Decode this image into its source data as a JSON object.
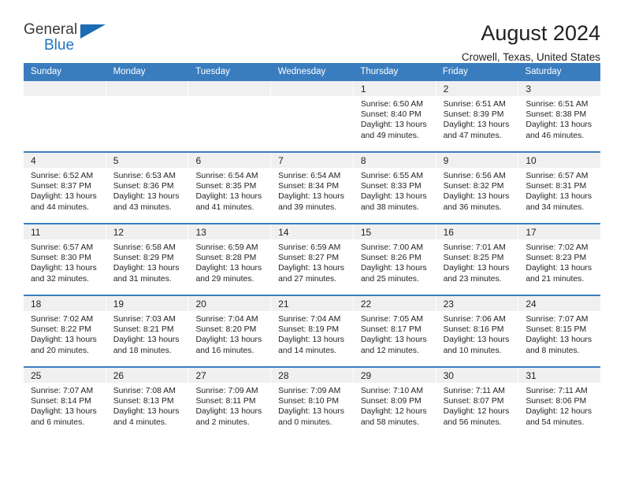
{
  "brand": {
    "name_top": "General",
    "name_bottom": "Blue",
    "color_primary": "#2077c0",
    "color_triangle": "#1b6cb3"
  },
  "header": {
    "title": "August 2024",
    "subtitle": "Crowell, Texas, United States"
  },
  "calendar": {
    "header_bg": "#3a7dbf",
    "day_header_bg": "#f0f0f0",
    "weekdays": [
      "Sunday",
      "Monday",
      "Tuesday",
      "Wednesday",
      "Thursday",
      "Friday",
      "Saturday"
    ],
    "weeks": [
      [
        {
          "day": "",
          "empty": true
        },
        {
          "day": "",
          "empty": true
        },
        {
          "day": "",
          "empty": true
        },
        {
          "day": "",
          "empty": true
        },
        {
          "day": "1",
          "sunrise": "Sunrise: 6:50 AM",
          "sunset": "Sunset: 8:40 PM",
          "daylight": "Daylight: 13 hours and 49 minutes."
        },
        {
          "day": "2",
          "sunrise": "Sunrise: 6:51 AM",
          "sunset": "Sunset: 8:39 PM",
          "daylight": "Daylight: 13 hours and 47 minutes."
        },
        {
          "day": "3",
          "sunrise": "Sunrise: 6:51 AM",
          "sunset": "Sunset: 8:38 PM",
          "daylight": "Daylight: 13 hours and 46 minutes."
        }
      ],
      [
        {
          "day": "4",
          "sunrise": "Sunrise: 6:52 AM",
          "sunset": "Sunset: 8:37 PM",
          "daylight": "Daylight: 13 hours and 44 minutes."
        },
        {
          "day": "5",
          "sunrise": "Sunrise: 6:53 AM",
          "sunset": "Sunset: 8:36 PM",
          "daylight": "Daylight: 13 hours and 43 minutes."
        },
        {
          "day": "6",
          "sunrise": "Sunrise: 6:54 AM",
          "sunset": "Sunset: 8:35 PM",
          "daylight": "Daylight: 13 hours and 41 minutes."
        },
        {
          "day": "7",
          "sunrise": "Sunrise: 6:54 AM",
          "sunset": "Sunset: 8:34 PM",
          "daylight": "Daylight: 13 hours and 39 minutes."
        },
        {
          "day": "8",
          "sunrise": "Sunrise: 6:55 AM",
          "sunset": "Sunset: 8:33 PM",
          "daylight": "Daylight: 13 hours and 38 minutes."
        },
        {
          "day": "9",
          "sunrise": "Sunrise: 6:56 AM",
          "sunset": "Sunset: 8:32 PM",
          "daylight": "Daylight: 13 hours and 36 minutes."
        },
        {
          "day": "10",
          "sunrise": "Sunrise: 6:57 AM",
          "sunset": "Sunset: 8:31 PM",
          "daylight": "Daylight: 13 hours and 34 minutes."
        }
      ],
      [
        {
          "day": "11",
          "sunrise": "Sunrise: 6:57 AM",
          "sunset": "Sunset: 8:30 PM",
          "daylight": "Daylight: 13 hours and 32 minutes."
        },
        {
          "day": "12",
          "sunrise": "Sunrise: 6:58 AM",
          "sunset": "Sunset: 8:29 PM",
          "daylight": "Daylight: 13 hours and 31 minutes."
        },
        {
          "day": "13",
          "sunrise": "Sunrise: 6:59 AM",
          "sunset": "Sunset: 8:28 PM",
          "daylight": "Daylight: 13 hours and 29 minutes."
        },
        {
          "day": "14",
          "sunrise": "Sunrise: 6:59 AM",
          "sunset": "Sunset: 8:27 PM",
          "daylight": "Daylight: 13 hours and 27 minutes."
        },
        {
          "day": "15",
          "sunrise": "Sunrise: 7:00 AM",
          "sunset": "Sunset: 8:26 PM",
          "daylight": "Daylight: 13 hours and 25 minutes."
        },
        {
          "day": "16",
          "sunrise": "Sunrise: 7:01 AM",
          "sunset": "Sunset: 8:25 PM",
          "daylight": "Daylight: 13 hours and 23 minutes."
        },
        {
          "day": "17",
          "sunrise": "Sunrise: 7:02 AM",
          "sunset": "Sunset: 8:23 PM",
          "daylight": "Daylight: 13 hours and 21 minutes."
        }
      ],
      [
        {
          "day": "18",
          "sunrise": "Sunrise: 7:02 AM",
          "sunset": "Sunset: 8:22 PM",
          "daylight": "Daylight: 13 hours and 20 minutes."
        },
        {
          "day": "19",
          "sunrise": "Sunrise: 7:03 AM",
          "sunset": "Sunset: 8:21 PM",
          "daylight": "Daylight: 13 hours and 18 minutes."
        },
        {
          "day": "20",
          "sunrise": "Sunrise: 7:04 AM",
          "sunset": "Sunset: 8:20 PM",
          "daylight": "Daylight: 13 hours and 16 minutes."
        },
        {
          "day": "21",
          "sunrise": "Sunrise: 7:04 AM",
          "sunset": "Sunset: 8:19 PM",
          "daylight": "Daylight: 13 hours and 14 minutes."
        },
        {
          "day": "22",
          "sunrise": "Sunrise: 7:05 AM",
          "sunset": "Sunset: 8:17 PM",
          "daylight": "Daylight: 13 hours and 12 minutes."
        },
        {
          "day": "23",
          "sunrise": "Sunrise: 7:06 AM",
          "sunset": "Sunset: 8:16 PM",
          "daylight": "Daylight: 13 hours and 10 minutes."
        },
        {
          "day": "24",
          "sunrise": "Sunrise: 7:07 AM",
          "sunset": "Sunset: 8:15 PM",
          "daylight": "Daylight: 13 hours and 8 minutes."
        }
      ],
      [
        {
          "day": "25",
          "sunrise": "Sunrise: 7:07 AM",
          "sunset": "Sunset: 8:14 PM",
          "daylight": "Daylight: 13 hours and 6 minutes."
        },
        {
          "day": "26",
          "sunrise": "Sunrise: 7:08 AM",
          "sunset": "Sunset: 8:13 PM",
          "daylight": "Daylight: 13 hours and 4 minutes."
        },
        {
          "day": "27",
          "sunrise": "Sunrise: 7:09 AM",
          "sunset": "Sunset: 8:11 PM",
          "daylight": "Daylight: 13 hours and 2 minutes."
        },
        {
          "day": "28",
          "sunrise": "Sunrise: 7:09 AM",
          "sunset": "Sunset: 8:10 PM",
          "daylight": "Daylight: 13 hours and 0 minutes."
        },
        {
          "day": "29",
          "sunrise": "Sunrise: 7:10 AM",
          "sunset": "Sunset: 8:09 PM",
          "daylight": "Daylight: 12 hours and 58 minutes."
        },
        {
          "day": "30",
          "sunrise": "Sunrise: 7:11 AM",
          "sunset": "Sunset: 8:07 PM",
          "daylight": "Daylight: 12 hours and 56 minutes."
        },
        {
          "day": "31",
          "sunrise": "Sunrise: 7:11 AM",
          "sunset": "Sunset: 8:06 PM",
          "daylight": "Daylight: 12 hours and 54 minutes."
        }
      ]
    ]
  }
}
